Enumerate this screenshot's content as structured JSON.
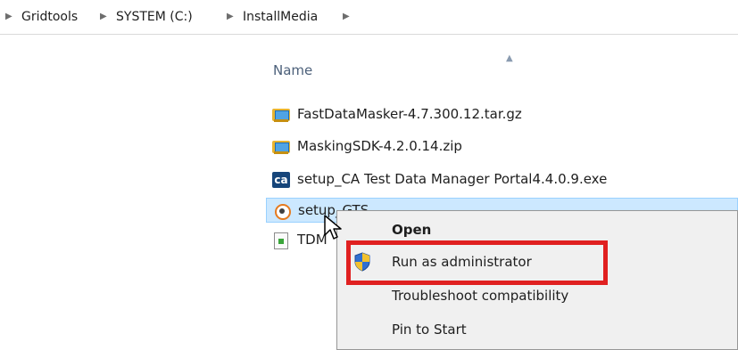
{
  "breadcrumb": {
    "items": [
      "Gridtools",
      "SYSTEM (C:)",
      "InstallMedia"
    ]
  },
  "file_list": {
    "column_header": "Name",
    "files": [
      {
        "name": "FastDataMasker-4.7.300.12.tar.gz",
        "icon": "archive-icon"
      },
      {
        "name": "MaskingSDK-4.2.0.14.zip",
        "icon": "archive-icon"
      },
      {
        "name": "setup_CA Test Data Manager Portal4.4.0.9.exe",
        "icon": "ca-app-icon"
      },
      {
        "name": "setup_GTS",
        "icon": "setup-icon",
        "selected": true
      },
      {
        "name": "TDM",
        "icon": "text-file-icon"
      }
    ]
  },
  "context_menu": {
    "items": [
      {
        "label": "Open",
        "default": true
      },
      {
        "label": "Run as administrator",
        "icon": "uac-shield-icon",
        "highlighted": true
      },
      {
        "label": "Troubleshoot compatibility"
      },
      {
        "label": "Pin to Start"
      }
    ]
  },
  "colors": {
    "selection_bg": "#cce8ff",
    "highlight_border": "#e02020",
    "menu_bg": "#f0f0f0",
    "header_text": "#4c607a"
  }
}
